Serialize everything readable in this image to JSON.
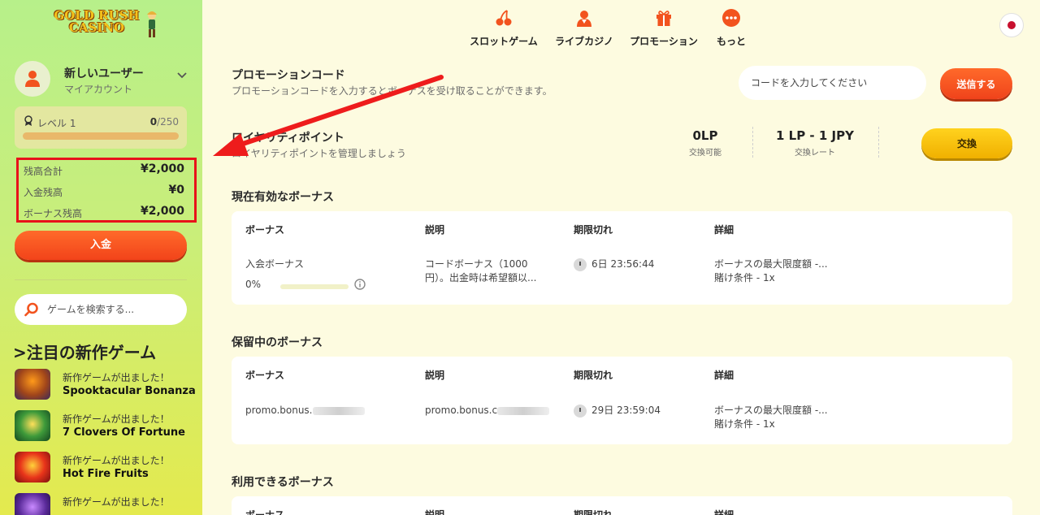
{
  "brand": {
    "logo_text": "GOLD RUSH CASINO",
    "accent": "#f2431a",
    "highlight": "#e8121a"
  },
  "user": {
    "name": "新しいユーザー",
    "subtitle": "マイアカウント"
  },
  "level": {
    "label": "レベル 1",
    "current": "0",
    "max": "/250",
    "progress_fraction": 0.0
  },
  "balances": {
    "total_label": "残高合計",
    "total_value": "¥2,000",
    "deposit_label": "入金残高",
    "deposit_value": "¥0",
    "bonus_label": "ボーナス残高",
    "bonus_value": "¥2,000"
  },
  "deposit_button": "入金",
  "search": {
    "placeholder": "ゲームを検索する..."
  },
  "new_games": {
    "title": ">注目の新作ゲーム",
    "items": [
      {
        "caption": "新作ゲームが出ました！",
        "name": "Spooktacular Bonanza"
      },
      {
        "caption": "新作ゲームが出ました！",
        "name": "7 Clovers Of Fortune"
      },
      {
        "caption": "新作ゲームが出ました！",
        "name": "Hot Fire Fruits"
      },
      {
        "caption": "新作ゲームが出ました！",
        "name": ""
      }
    ]
  },
  "nav": {
    "slots": "スロットゲーム",
    "live": "ライブカジノ",
    "promo": "プロモーション",
    "more": "もっと"
  },
  "promo_code": {
    "title": "プロモーションコード",
    "subtitle": "プロモーションコードを入力するとボーナスを受け取ることができます。",
    "placeholder": "コードを入力してください",
    "submit": "送信する"
  },
  "loyalty": {
    "title": "ロイヤリティポイント",
    "subtitle": "ロイヤリティポイントを管理しましょう",
    "available_value": "0LP",
    "available_label": "交換可能",
    "rate_value": "1 LP - 1 JPY",
    "rate_label": "交換レート",
    "exchange_button": "交換"
  },
  "active_bonuses": {
    "title": "現在有効なボーナス",
    "headers": [
      "ボーナス",
      "説明",
      "期限切れ",
      "詳細"
    ],
    "row": {
      "name": "入会ボーナス",
      "progress": "0%",
      "desc_1": "コードボーナス（1000",
      "desc_2": "円）。出金時は希望額以...",
      "expires": "6日 23:56:44",
      "detail_1": "ボーナスの最大限度額 -...",
      "detail_2": "賭け条件 - 1x"
    }
  },
  "pending_bonuses": {
    "title": "保留中のボーナス",
    "headers": [
      "ボーナス",
      "説明",
      "期限切れ",
      "詳細"
    ],
    "row": {
      "name": "promo.bonus.",
      "desc": "promo.bonus.c",
      "expires": "29日 23:59:04",
      "detail_1": "ボーナスの最大限度額 -...",
      "detail_2": "賭け条件 - 1x"
    }
  },
  "available_bonuses": {
    "title": "利用できるボーナス",
    "headers": [
      "ボーナス",
      "説明",
      "期限切れ",
      "詳細"
    ]
  }
}
